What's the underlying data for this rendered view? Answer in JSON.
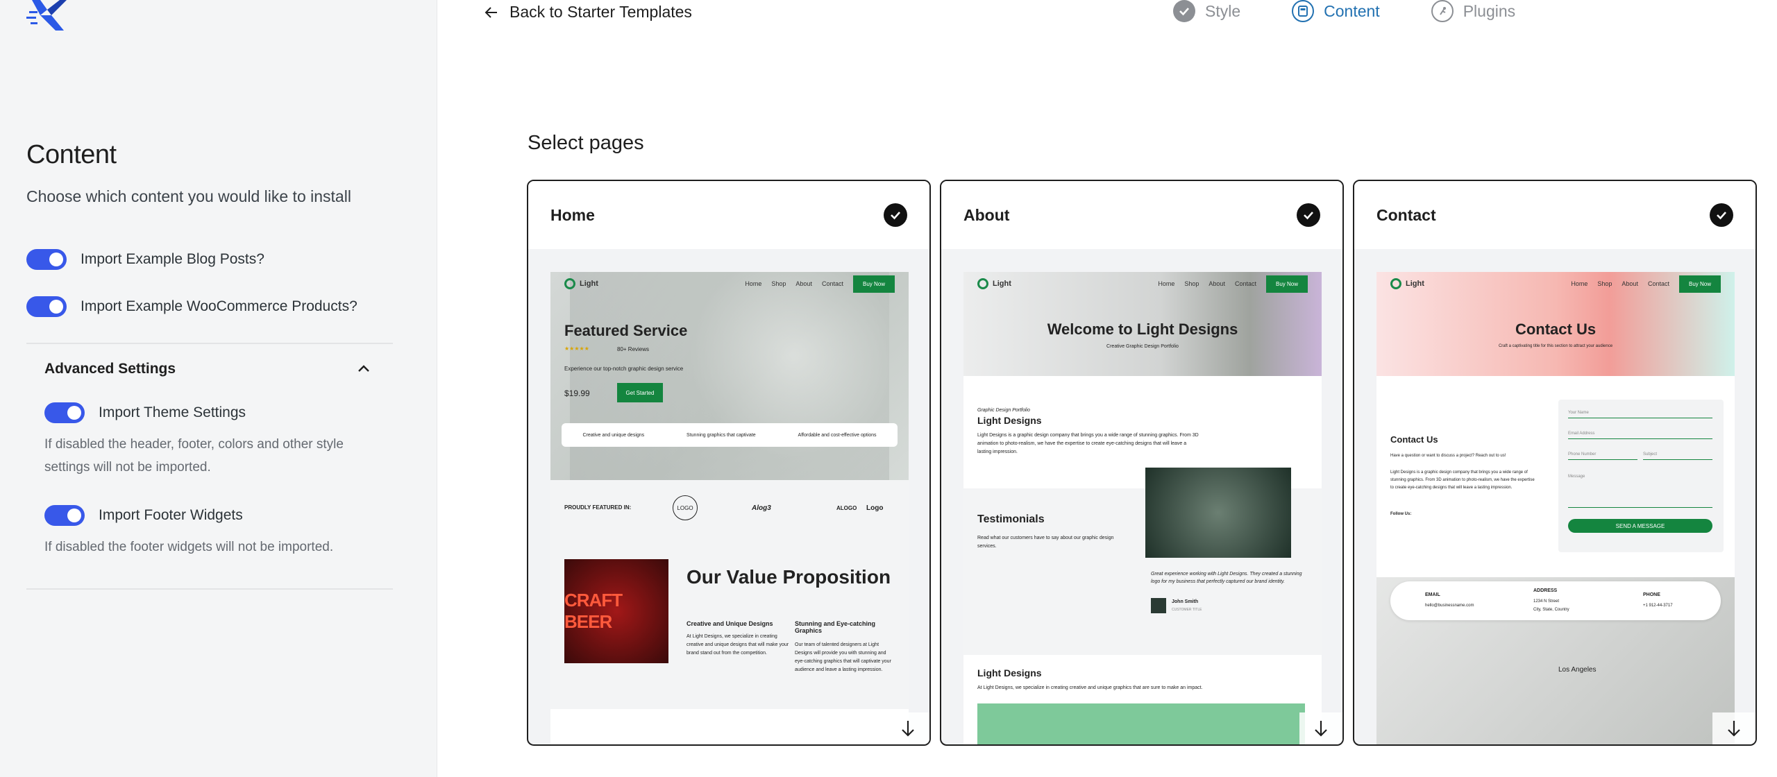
{
  "sidebar": {
    "title": "Content",
    "subtitle": "Choose which content you would like to install",
    "toggles": [
      {
        "label": "Import Example Blog Posts?",
        "on": true
      },
      {
        "label": "Import Example WooCommerce Products?",
        "on": true
      }
    ],
    "advanced": {
      "title": "Advanced Settings",
      "theme_label": "Import Theme Settings",
      "theme_help": "If disabled the header, footer, colors and other style settings will not be imported.",
      "footer_label": "Import Footer Widgets",
      "footer_help": "If disabled the footer widgets will not be imported."
    }
  },
  "header": {
    "back_label": "Back to Starter Templates",
    "steps": [
      {
        "label": "Style",
        "icon": "check-circle-icon",
        "state": "done"
      },
      {
        "label": "Content",
        "icon": "content-icon",
        "state": "active"
      },
      {
        "label": "Plugins",
        "icon": "plugin-icon",
        "state": "todo"
      }
    ]
  },
  "main": {
    "title": "Select pages",
    "pages": [
      {
        "name": "Home",
        "selected": true
      },
      {
        "name": "About",
        "selected": true
      },
      {
        "name": "Contact",
        "selected": true
      }
    ]
  },
  "previews": {
    "nav": {
      "brand": "Light",
      "links": [
        "Home",
        "Shop",
        "About",
        "Contact"
      ],
      "cta": "Buy Now"
    },
    "home": {
      "hero_title": "Featured Service",
      "reviews": "80+ Reviews",
      "hero_text": "Experience our top-notch graphic design service",
      "price": "$19.99",
      "hero_cta": "Get Started",
      "features": [
        "Creative and unique designs",
        "Stunning graphics that captivate",
        "Affordable and cost-effective options"
      ],
      "featured_in": "PROUDLY FEATURED IN:",
      "logos": [
        "LOGO",
        "Alog3",
        "ALOGO",
        "Logo"
      ],
      "image_text": "CRAFT BEER",
      "value_title": "Our Value Proposition",
      "col1_title": "Creative and Unique Designs",
      "col1_text": "At Light Designs, we specialize in creating creative and unique designs that will make your brand stand out from the competition.",
      "col2_title": "Stunning and Eye-catching Graphics",
      "col2_text": "Our team of talented designers at Light Designs will provide you with stunning and eye-catching graphics that will captivate your audience and leave a lasting impression."
    },
    "about": {
      "hero_title": "Welcome to Light Designs",
      "hero_sub": "Creative Graphic Design Portfolio",
      "kicker": "Graphic Design Portfolio",
      "section_title": "Light Designs",
      "section_text": "Light Designs is a graphic design company that brings you a wide range of stunning graphics. From 3D animation to photo-realism, we have the expertise to create eye-catching designs that will leave a lasting impression.",
      "testimonials_title": "Testimonials",
      "testimonials_text": "Read what our customers have to say about our graphic design services.",
      "quote": "Great experience working with Light Designs. They created a stunning logo for my business that perfectly captured our brand identity.",
      "person": "John Smith",
      "person_role": "CUSTOMER TITLE",
      "footer_title": "Light Designs",
      "footer_text": "At Light Designs, we specialize in creating creative and unique graphics that are sure to make an impact."
    },
    "contact": {
      "hero_title": "Contact Us",
      "hero_sub": "Craft a captivating title for this section to attract your audience",
      "section_title": "Contact Us",
      "section_text1": "Have a question or want to discuss a project? Reach out to us!",
      "section_text2": "Light Designs is a graphic design company that brings you a wide range of stunning graphics. From 3D animation to photo-realism, we have the expertise to create eye-catching designs that will leave a lasting impression.",
      "follow": "Follow Us:",
      "fields": [
        "Your Name",
        "Email Address",
        "Phone Number",
        "Subject",
        "Message"
      ],
      "send": "SEND A MESSAGE",
      "email_label": "EMAIL",
      "email_value": "hello@businessname.com",
      "address_label": "ADDRESS",
      "address_value1": "1234 N Street",
      "address_value2": "City, State, Country",
      "phone_label": "PHONE",
      "phone_value": "+1 912-44-3717",
      "map_city": "Los Angeles"
    }
  },
  "colors": {
    "accent": "#3858e9",
    "step_active": "#2271b1",
    "preview_green": "#14853f"
  }
}
